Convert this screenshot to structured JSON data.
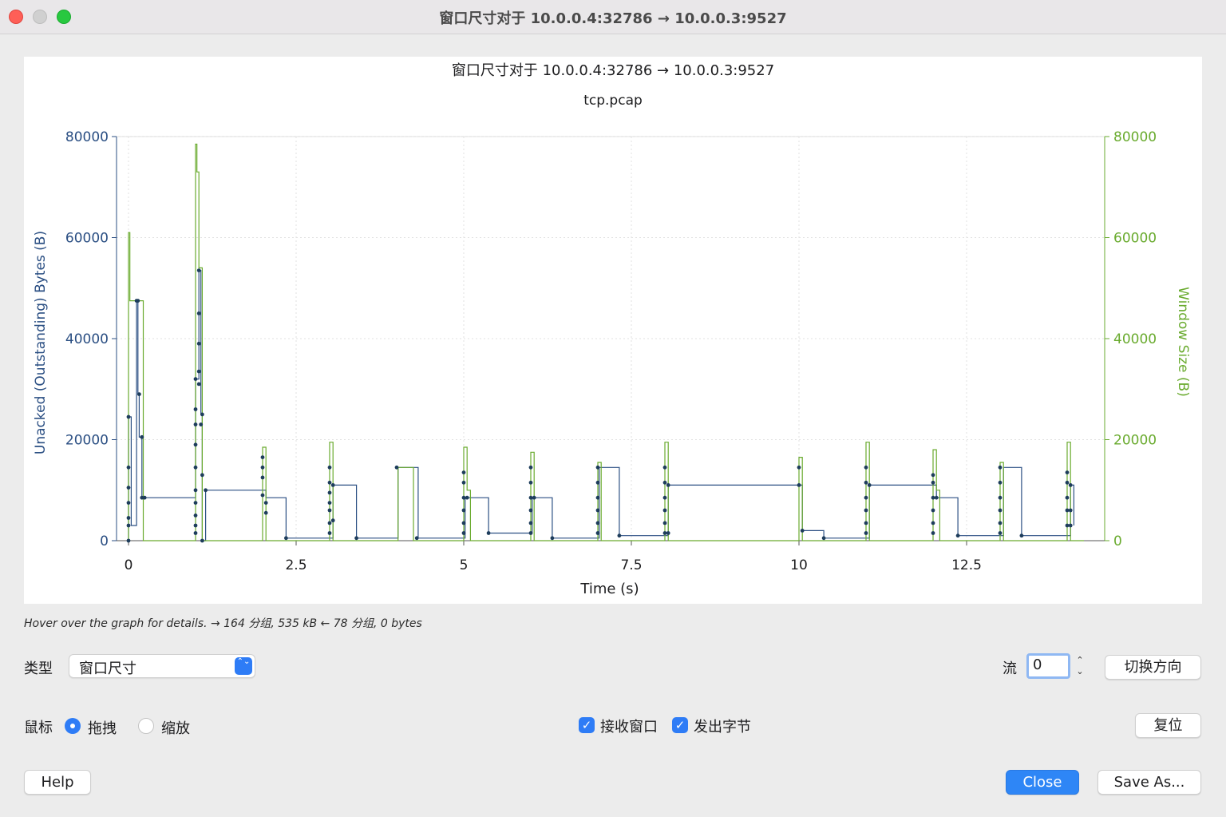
{
  "window": {
    "title": "窗口尺寸对于 10.0.0.4:32786 → 10.0.0.3:9527"
  },
  "hover_info": "Hover over the graph for details. → 164 分组, 535 kB ← 78 分组, 0 bytes",
  "controls": {
    "type_label": "类型",
    "type_value": "窗口尺寸",
    "stream_label": "流",
    "stream_value": "0",
    "switch_direction": "切换方向",
    "mouse_label": "鼠标",
    "mode_drag": "拖拽",
    "mode_zoom": "缩放",
    "recv_window": "接收窗口",
    "bytes_out": "发出字节",
    "reset": "复位",
    "help": "Help",
    "close": "Close",
    "save_as": "Save As...",
    "check_mark": "✓",
    "select_arrows": "⌃⌄",
    "step_up": "⌃",
    "step_down": "⌄"
  },
  "colors": {
    "unacked": "#2b4f83",
    "window": "#6aab2f",
    "primary": "#2e86f6"
  },
  "chart_data": {
    "type": "line",
    "title": "窗口尺寸对于 10.0.0.4:32786 → 10.0.0.3:9527",
    "subtitle": "tcp.pcap",
    "xlabel": "Time (s)",
    "ylabel_left": "Unacked (Outstanding) Bytes (B)",
    "ylabel_right": "Window Size (B)",
    "xlim": [
      0,
      14.5
    ],
    "ylim": [
      0,
      80000
    ],
    "x_ticks": [
      "0",
      "2.5",
      "5",
      "7.5",
      "10",
      "12.5"
    ],
    "x_tick_values": [
      0,
      2.5,
      5,
      7.5,
      10,
      12.5
    ],
    "y_ticks": [
      "0",
      "20000",
      "40000",
      "60000",
      "80000"
    ],
    "y_tick_values": [
      0,
      20000,
      40000,
      60000,
      80000
    ],
    "grid": true,
    "series": [
      {
        "name": "Unacked (Outstanding) Bytes (B)",
        "points": [
          [
            0,
            0
          ],
          [
            0,
            24500
          ],
          [
            0.04,
            3000
          ],
          [
            0.12,
            3000
          ],
          [
            0.12,
            47500
          ],
          [
            0.14,
            29000
          ],
          [
            0.16,
            20500
          ],
          [
            0.2,
            8500
          ],
          [
            1.0,
            8500
          ],
          [
            1.0,
            32000
          ],
          [
            1.05,
            53500
          ],
          [
            1.08,
            25000
          ],
          [
            1.1,
            0
          ],
          [
            1.15,
            10000
          ],
          [
            2.0,
            10000
          ],
          [
            2.05,
            8500
          ],
          [
            2.3,
            8500
          ],
          [
            2.35,
            500
          ],
          [
            3.0,
            500
          ],
          [
            3.05,
            11000
          ],
          [
            3.35,
            11000
          ],
          [
            3.4,
            500
          ],
          [
            4.0,
            500
          ],
          [
            4.02,
            14500
          ],
          [
            4.3,
            14500
          ],
          [
            4.32,
            500
          ],
          [
            5.0,
            500
          ],
          [
            5.02,
            8500
          ],
          [
            5.35,
            8500
          ],
          [
            5.37,
            1500
          ],
          [
            6.0,
            1500
          ],
          [
            6.02,
            8500
          ],
          [
            6.3,
            8500
          ],
          [
            6.32,
            500
          ],
          [
            7.0,
            500
          ],
          [
            7.02,
            14500
          ],
          [
            7.3,
            14500
          ],
          [
            7.32,
            1000
          ],
          [
            8.0,
            1000
          ],
          [
            8.05,
            11000
          ],
          [
            10.0,
            11000
          ],
          [
            10.05,
            2000
          ],
          [
            10.35,
            2000
          ],
          [
            10.37,
            500
          ],
          [
            11.0,
            500
          ],
          [
            11.05,
            11000
          ],
          [
            11.95,
            11000
          ],
          [
            12.05,
            8500
          ],
          [
            12.35,
            8500
          ],
          [
            12.37,
            1000
          ],
          [
            13.0,
            1000
          ],
          [
            13.05,
            14500
          ],
          [
            13.3,
            14500
          ],
          [
            13.32,
            1000
          ],
          [
            14.0,
            1000
          ],
          [
            14.05,
            11000
          ],
          [
            14.1,
            3000
          ]
        ],
        "markers": [
          [
            0,
            0
          ],
          [
            0,
            3000
          ],
          [
            0,
            4500
          ],
          [
            0,
            7500
          ],
          [
            0,
            10500
          ],
          [
            0,
            14500
          ],
          [
            0,
            24500
          ],
          [
            0.12,
            47500
          ],
          [
            0.14,
            47500
          ],
          [
            0.2,
            20500
          ],
          [
            0.16,
            29000
          ],
          [
            0.2,
            8500
          ],
          [
            0.24,
            8500
          ],
          [
            1.0,
            1500
          ],
          [
            1.0,
            3000
          ],
          [
            1.0,
            5000
          ],
          [
            1.0,
            7500
          ],
          [
            1.0,
            10000
          ],
          [
            1.0,
            14500
          ],
          [
            1.0,
            19000
          ],
          [
            1.0,
            23000
          ],
          [
            1.0,
            26000
          ],
          [
            1.0,
            32000
          ],
          [
            1.05,
            31000
          ],
          [
            1.05,
            33500
          ],
          [
            1.05,
            39000
          ],
          [
            1.05,
            45000
          ],
          [
            1.05,
            53500
          ],
          [
            1.08,
            23000
          ],
          [
            1.1,
            25000
          ],
          [
            1.1,
            13000
          ],
          [
            1.15,
            10000
          ],
          [
            1.1,
            0
          ],
          [
            2.0,
            9000
          ],
          [
            2.0,
            12500
          ],
          [
            2.0,
            14500
          ],
          [
            2.0,
            16500
          ],
          [
            2.05,
            7500
          ],
          [
            2.05,
            5500
          ],
          [
            2.35,
            500
          ],
          [
            3.0,
            1500
          ],
          [
            3.0,
            3500
          ],
          [
            3.0,
            6000
          ],
          [
            3.0,
            7500
          ],
          [
            3.0,
            9500
          ],
          [
            3.0,
            11500
          ],
          [
            3.0,
            14500
          ],
          [
            3.05,
            11000
          ],
          [
            3.05,
            4000
          ],
          [
            3.4,
            500
          ],
          [
            4.0,
            14500
          ],
          [
            4.3,
            500
          ],
          [
            5.0,
            1500
          ],
          [
            5.0,
            3500
          ],
          [
            5.0,
            6000
          ],
          [
            5.0,
            8500
          ],
          [
            5.0,
            11500
          ],
          [
            5.0,
            13500
          ],
          [
            5.05,
            8500
          ],
          [
            5.37,
            1500
          ],
          [
            6.0,
            1500
          ],
          [
            6.0,
            3500
          ],
          [
            6.0,
            6000
          ],
          [
            6.0,
            8500
          ],
          [
            6.0,
            11500
          ],
          [
            6.0,
            14500
          ],
          [
            6.05,
            8500
          ],
          [
            6.32,
            500
          ],
          [
            7.0,
            1500
          ],
          [
            7.0,
            3500
          ],
          [
            7.0,
            6000
          ],
          [
            7.0,
            8500
          ],
          [
            7.0,
            11500
          ],
          [
            7.0,
            14500
          ],
          [
            7.32,
            1000
          ],
          [
            8.0,
            1500
          ],
          [
            8.0,
            3500
          ],
          [
            8.0,
            6000
          ],
          [
            8.0,
            8500
          ],
          [
            8.0,
            11500
          ],
          [
            8.0,
            14500
          ],
          [
            8.05,
            11000
          ],
          [
            8.05,
            1500
          ],
          [
            10.0,
            11000
          ],
          [
            10.0,
            14500
          ],
          [
            10.05,
            2000
          ],
          [
            10.37,
            500
          ],
          [
            11.0,
            1500
          ],
          [
            11.0,
            3500
          ],
          [
            11.0,
            6000
          ],
          [
            11.0,
            8500
          ],
          [
            11.0,
            11500
          ],
          [
            11.0,
            14500
          ],
          [
            11.05,
            11000
          ],
          [
            12.0,
            1500
          ],
          [
            12.0,
            3500
          ],
          [
            12.0,
            6000
          ],
          [
            12.0,
            8500
          ],
          [
            12.0,
            11500
          ],
          [
            12.0,
            13000
          ],
          [
            12.05,
            8500
          ],
          [
            12.37,
            1000
          ],
          [
            13.0,
            1500
          ],
          [
            13.0,
            3500
          ],
          [
            13.0,
            6000
          ],
          [
            13.0,
            8500
          ],
          [
            13.0,
            11500
          ],
          [
            13.0,
            14500
          ],
          [
            13.32,
            1000
          ],
          [
            14.0,
            3000
          ],
          [
            14.0,
            6000
          ],
          [
            14.0,
            8500
          ],
          [
            14.0,
            11500
          ],
          [
            14.0,
            13500
          ],
          [
            14.05,
            11000
          ],
          [
            14.05,
            6000
          ],
          [
            14.05,
            3000
          ]
        ]
      },
      {
        "name": "Window Size (B)",
        "points": [
          [
            0,
            0
          ],
          [
            0,
            61000
          ],
          [
            0.02,
            47500
          ],
          [
            0.2,
            47500
          ],
          [
            0.22,
            0
          ],
          [
            1.0,
            0
          ],
          [
            1.0,
            78500
          ],
          [
            1.02,
            73000
          ],
          [
            1.05,
            54000
          ],
          [
            1.1,
            0
          ],
          [
            2.0,
            0
          ],
          [
            2.0,
            18500
          ],
          [
            2.05,
            0
          ],
          [
            3.0,
            0
          ],
          [
            3.0,
            19500
          ],
          [
            3.05,
            0
          ],
          [
            4.0,
            0
          ],
          [
            4.02,
            14500
          ],
          [
            4.25,
            0
          ],
          [
            5.0,
            0
          ],
          [
            5.0,
            18500
          ],
          [
            5.05,
            10000
          ],
          [
            5.1,
            0
          ],
          [
            6.0,
            0
          ],
          [
            6.0,
            17500
          ],
          [
            6.05,
            0
          ],
          [
            7.0,
            0
          ],
          [
            7.0,
            15500
          ],
          [
            7.05,
            0
          ],
          [
            8.0,
            0
          ],
          [
            8.0,
            19500
          ],
          [
            8.05,
            0
          ],
          [
            10.0,
            0
          ],
          [
            10.0,
            16500
          ],
          [
            10.05,
            0
          ],
          [
            11.0,
            0
          ],
          [
            11.0,
            19500
          ],
          [
            11.05,
            0
          ],
          [
            12.0,
            0
          ],
          [
            12.0,
            18000
          ],
          [
            12.05,
            10000
          ],
          [
            12.1,
            0
          ],
          [
            13.0,
            0
          ],
          [
            13.0,
            15500
          ],
          [
            13.05,
            0
          ],
          [
            14.0,
            0
          ],
          [
            14.0,
            19500
          ],
          [
            14.05,
            0
          ],
          [
            14.25,
            0
          ]
        ]
      }
    ]
  }
}
